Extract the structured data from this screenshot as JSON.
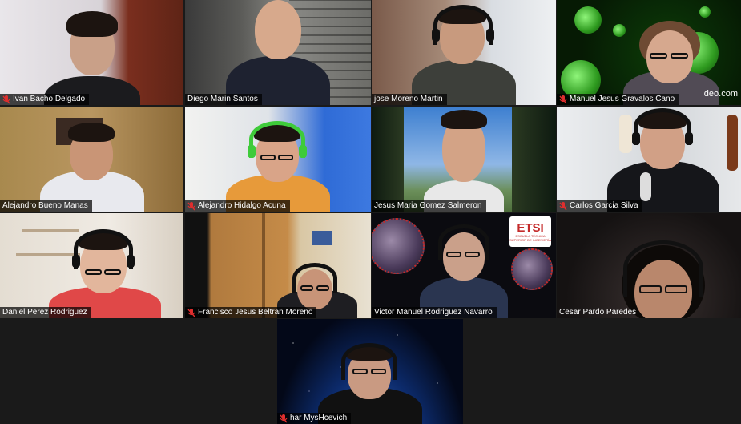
{
  "meeting": {
    "participants": [
      {
        "name": "Ivan Bacho Delgado",
        "muted": true,
        "speaking": false
      },
      {
        "name": "Diego Marin Santos",
        "muted": false,
        "speaking": true
      },
      {
        "name": "jose Moreno Martin",
        "muted": false,
        "speaking": false
      },
      {
        "name": "Manuel Jesus Gravalos Cano",
        "muted": true,
        "speaking": false,
        "watermark": "deo.com"
      },
      {
        "name": "Alejandro Bueno Manas",
        "muted": false,
        "speaking": false
      },
      {
        "name": "Alejandro Hidalgo Acuna",
        "muted": true,
        "speaking": false
      },
      {
        "name": "Jesus Maria Gomez Salmeron",
        "muted": false,
        "speaking": false
      },
      {
        "name": "Carlos Garcia Silva",
        "muted": true,
        "speaking": false
      },
      {
        "name": "Daniel Perez Rodriguez",
        "muted": false,
        "speaking": false
      },
      {
        "name": "Francisco Jesus Beltran Moreno",
        "muted": true,
        "speaking": false
      },
      {
        "name": "Victor Manuel Rodriguez Navarro",
        "muted": false,
        "speaking": false,
        "logo_text": "ETSI",
        "logo_subtext": "ESCUELA TÉCNICA SUPERIOR DE INGENIERÍA"
      },
      {
        "name": "Cesar Pardo Paredes",
        "muted": false,
        "speaking": false
      },
      {
        "name": "har MysHcevich",
        "muted": true,
        "speaking": false
      }
    ]
  },
  "icons": {
    "muted": "microphone-muted-icon"
  },
  "colors": {
    "active_speaker_border": "#e8e24a",
    "mute_icon": "#e02e2e",
    "background": "#1a1a1a"
  }
}
